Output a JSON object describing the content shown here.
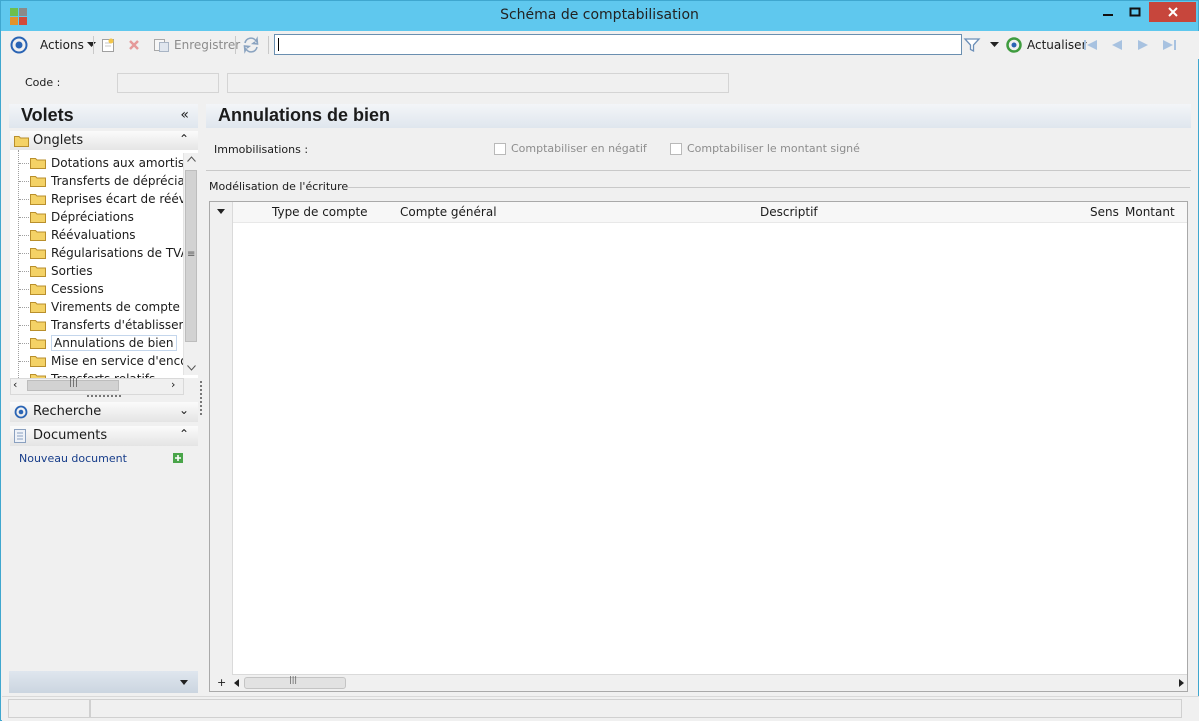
{
  "window": {
    "title": "Schéma de comptabilisation"
  },
  "toolbar": {
    "actions_label": "Actions",
    "save_label": "Enregistrer",
    "search_value": "",
    "refresh_label": "Actualiser"
  },
  "form": {
    "code_label": "Code :",
    "code_value": "",
    "desc_value": ""
  },
  "sidebar": {
    "title": "Volets",
    "tabs_section": "Onglets",
    "items": [
      {
        "label": "Dotations aux amortissements"
      },
      {
        "label": "Transferts de dépréciations"
      },
      {
        "label": "Reprises écart de réévaluation"
      },
      {
        "label": "Dépréciations"
      },
      {
        "label": "Réévaluations"
      },
      {
        "label": "Régularisations de TVA"
      },
      {
        "label": "Sorties"
      },
      {
        "label": "Cessions"
      },
      {
        "label": "Virements de compte à compte"
      },
      {
        "label": "Transferts d'établissement"
      },
      {
        "label": "Annulations de bien",
        "selected": true
      },
      {
        "label": "Mise en service d'encours"
      },
      {
        "label": "Transferts relatifs"
      }
    ],
    "search_section": "Recherche",
    "documents_section": "Documents",
    "new_document_link": "Nouveau document"
  },
  "main": {
    "title": "Annulations de bien",
    "immobilisations_label": "Immobilisations :",
    "chk_negative": "Comptabiliser en négatif",
    "chk_signed": "Comptabiliser le montant signé",
    "group_title": "Modélisation de l'écriture",
    "columns": [
      "Type de compte",
      "Compte général",
      "Descriptif",
      "Sens",
      "Montant"
    ]
  },
  "colors": {
    "titlebar": "#5fc8ee",
    "accent": "#2a64b4"
  }
}
